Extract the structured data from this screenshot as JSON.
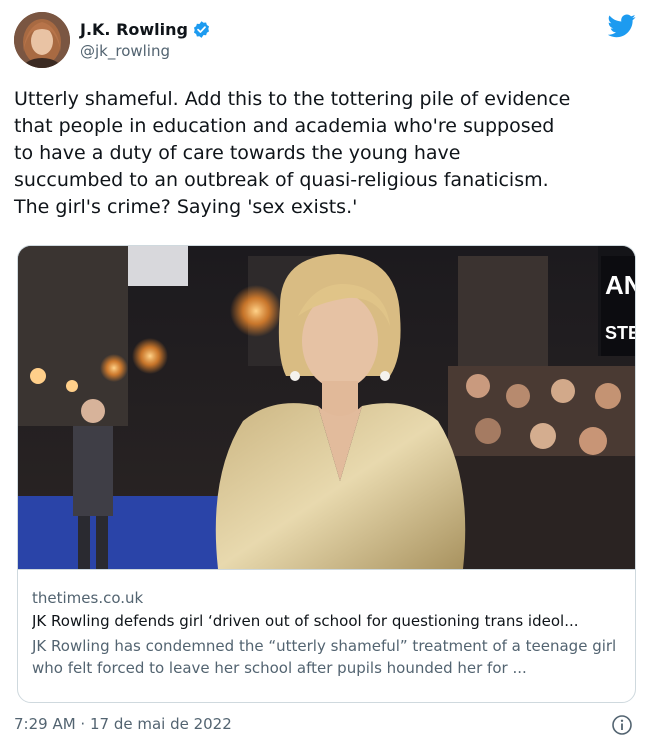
{
  "author": {
    "display_name": "J.K. Rowling",
    "handle": "@jk_rowling",
    "verified": true,
    "avatar_icon": "profile-photo"
  },
  "tweet": {
    "text": "Utterly shameful. Add this to the tottering pile of evidence\nthat people in education and academia who're supposed\nto have a duty of care towards the young have\nsuccumbed to an outbreak of quasi-religious fanaticism.\nThe girl's crime? Saying 'sex exists.'",
    "timestamp": "7:29 AM · 17 de mai de 2022"
  },
  "card": {
    "domain": "thetimes.co.uk",
    "title": "JK Rowling defends girl ‘driven out of school for questioning trans ideol...",
    "description": "JK Rowling has condemned the “utterly shameful” treatment of a teenage girl who felt forced to leave her school after pupils hounded her for ...",
    "image_icon": "article-photo",
    "sign_text": "AN\nSTEA"
  },
  "colors": {
    "brand": "#1d9bf0",
    "text_primary": "#0f1419",
    "text_secondary": "#536471",
    "border": "#cfd9de"
  },
  "icons": {
    "platform": "twitter-bird-icon",
    "verified": "verified-badge-icon",
    "info": "info-icon"
  }
}
